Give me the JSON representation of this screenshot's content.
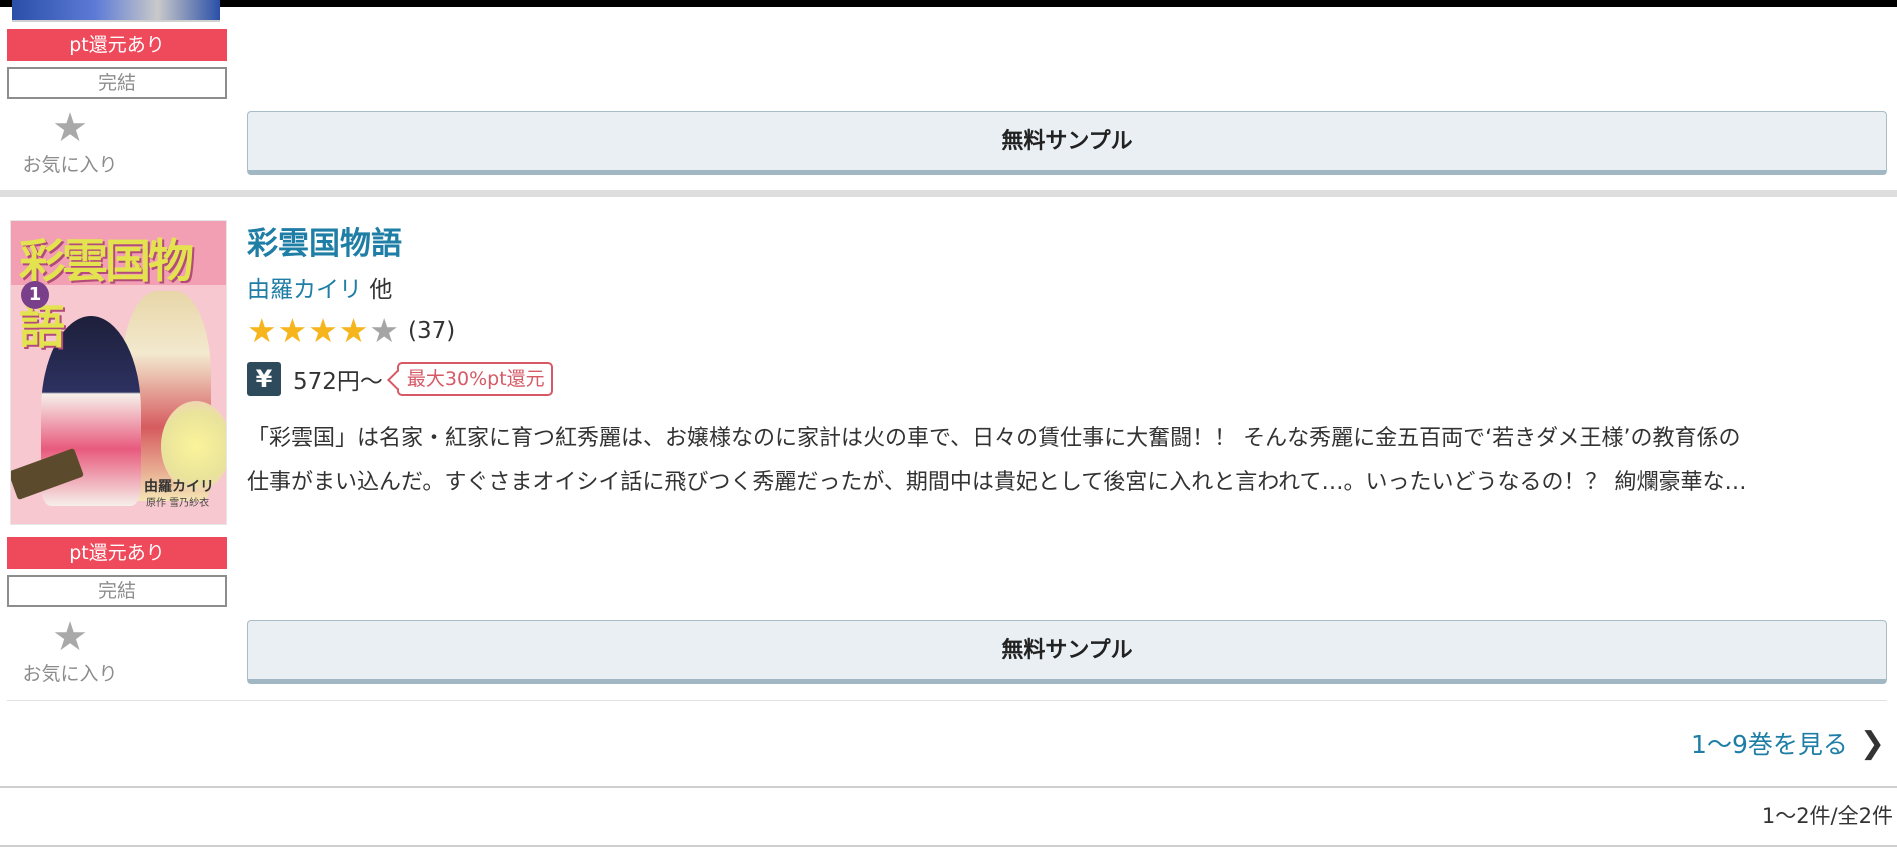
{
  "item1": {
    "pt_badge": "pt還元あり",
    "completed_badge": "完結",
    "favorite_label": "お気に入り",
    "sample_button": "無料サンプル"
  },
  "item2": {
    "title": "彩雲国物語",
    "author": "由羅カイリ",
    "author_suffix": "他",
    "rating": 4,
    "rating_max": 5,
    "rating_count": "(37)",
    "price": "572円〜",
    "pt_tag": "最大30%pt還元",
    "description_line1": "「彩雲国」は名家・紅家に育つ紅秀麗は、お嬢様なのに家計は火の車で、日々の賃仕事に大奮闘！！ そんな秀麗に金五百両で‘若きダメ王様’の教育係の",
    "description_line2": "仕事がまい込んだ。すぐさまオイシイ話に飛びつく秀麗だったが、期間中は貴妃として後宮に入れと言われて…。いったいどうなるの！？ 絢爛豪華な…",
    "pt_badge": "pt還元あり",
    "completed_badge": "完結",
    "favorite_label": "お気に入り",
    "sample_button": "無料サンプル",
    "cover": {
      "title": "彩雲国物語",
      "volume": "1",
      "author": "由羅カイリ",
      "credit": "原作 雪乃紗衣"
    }
  },
  "more_link": "1〜9巻を見る",
  "result_count": "1〜2件/全2件",
  "icons": {
    "star": "star-icon",
    "yen": "yen-icon",
    "chevron": "chevron-right-icon"
  },
  "colors": {
    "accent_link": "#1f7ea5",
    "pt_badge": "#ef4a5b",
    "star_on": "#f6b51c",
    "star_off": "#a5a5a5"
  }
}
